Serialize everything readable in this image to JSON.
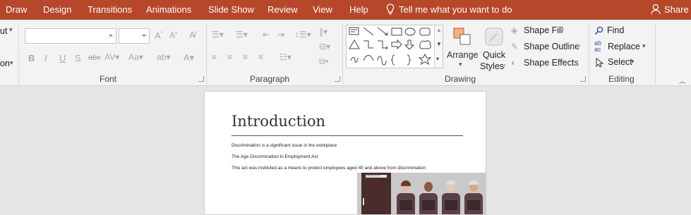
{
  "menu": {
    "tabs": [
      "Draw",
      "Design",
      "Transitions",
      "Animations",
      "Slide Show",
      "Review",
      "View",
      "Help"
    ],
    "tell_me": "Tell me what you want to do",
    "share": "Share"
  },
  "ribbon": {
    "clipboard_partial": {
      "cut": "ut",
      "format": "on"
    },
    "font": {
      "label": "Font",
      "font_name": "",
      "font_size": ""
    },
    "paragraph": {
      "label": "Paragraph"
    },
    "drawing": {
      "label": "Drawing",
      "arrange": "Arrange",
      "quick_styles_1": "Quick",
      "quick_styles_2": "Styles",
      "shape_fill": "Shape Fill",
      "shape_outline": "Shape Outline",
      "shape_effects": "Shape Effects"
    },
    "editing": {
      "label": "Editing",
      "find": "Find",
      "replace": "Replace",
      "select": "Select"
    }
  },
  "slide": {
    "title": "Introduction",
    "bullets": [
      "Discrimination is a significant issue in the workplace",
      "The Age Discrimination in Employment Act",
      "This act was instituted as a means to protect employees aged 40 and above from discrimination"
    ],
    "photo_sign": "HUMAN RESOURCES"
  },
  "colors": {
    "accent": "#b7472a",
    "ribbon": "#f3f3f3",
    "canvas": "#e5e5e5"
  }
}
